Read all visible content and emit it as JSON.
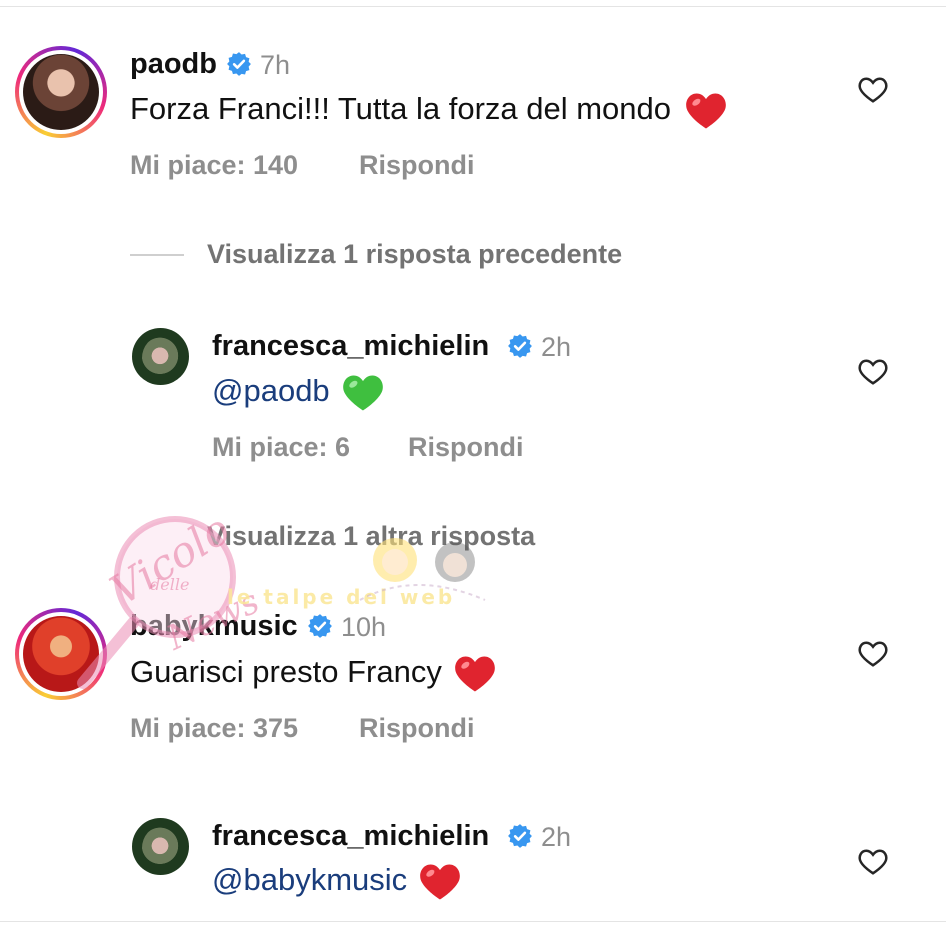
{
  "comments": [
    {
      "username": "paodb",
      "time": "7h",
      "text": "Forza Franci!!! Tutta la forza del mondo",
      "emoji": "red-heart",
      "likes": "Mi piace: 140",
      "reply": "Rispondi"
    },
    {
      "username": "babykmusic",
      "time": "10h",
      "text": "Guarisci presto Francy",
      "emoji": "red-heart",
      "likes": "Mi piace: 375",
      "reply": "Rispondi"
    }
  ],
  "replies": [
    {
      "username": "francesca_michielin",
      "time": "2h",
      "mention": "@paodb",
      "emoji": "green-heart",
      "likes": "Mi piace: 6",
      "reply": "Rispondi"
    },
    {
      "username": "francesca_michielin",
      "time": "2h",
      "mention": "@babykmusic",
      "emoji": "red-heart"
    }
  ],
  "view_previous": "Visualizza 1 risposta precedente",
  "view_more": "Visualizza 1 altra risposta",
  "watermark": {
    "logo_main": "Vicolo",
    "logo_small": "delle",
    "logo_end": "News",
    "site": "le talpe del web"
  },
  "colors": {
    "verified": "#3897f0",
    "heart_red": "#e0242f",
    "heart_green": "#3fbf3f",
    "meta_gray": "#8e8e8e",
    "mention": "#1a3d7c"
  },
  "icons": [
    "verified-badge",
    "like-heart-outline",
    "red-heart-emoji",
    "green-heart-emoji"
  ]
}
